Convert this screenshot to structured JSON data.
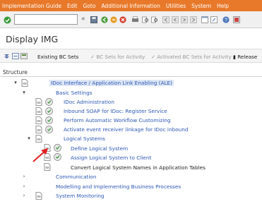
{
  "menu": [
    "Implementation Guide",
    "Edit",
    "Goto",
    "Additional Information",
    "Utilities",
    "System",
    "Help"
  ],
  "toolbar": {
    "command_value": "",
    "back_glyph": "«"
  },
  "title": "Display IMG",
  "app_toolbar": {
    "existing_bc_sets": "Existing BC Sets",
    "bc_sets_for_activity": "BC Sets for Activity",
    "activated_bc_sets": "Activated BC Sets for Activity",
    "release": "Release"
  },
  "structure_label": "Structure",
  "tree": {
    "root": "IDoc Interface / Application Link Enabling (ALE)",
    "basic_settings": "Basic Settings",
    "idoc_admin": "IDoc Administration",
    "inbound_soap": "Inbound SOAP for IDoc: Register Service",
    "workflow": "Perform Automatic Workflow Customizing",
    "activate_receiver": "Activate event receiver linkage for IDoc inbound",
    "logical_systems": "Logical Systems",
    "define_ls": "Define Logical System",
    "assign_ls": "Assign Logical System to Client",
    "convert_ls": "Convert Logical System Names in Application Tables",
    "communication": "Communication",
    "modelling": "Modelling and Implementing Business Processes",
    "monitoring": "System Monitoring"
  },
  "colors": {
    "menu_bar": "#e8792a",
    "link_blue": "#2b57b5",
    "pointer_arrow": "#e02020"
  }
}
